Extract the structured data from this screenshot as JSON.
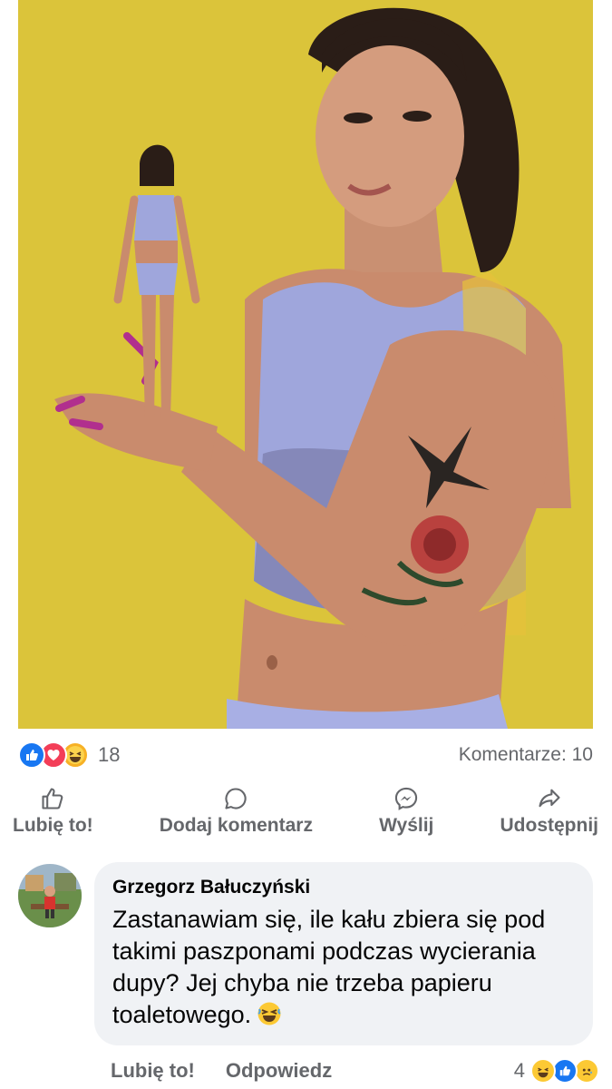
{
  "post": {
    "image_icon": "photo-woman-holding-doll"
  },
  "reactions": {
    "icons": [
      "like-icon",
      "love-icon",
      "haha-icon"
    ],
    "count": "18",
    "comments_label": "Komentarze: 10"
  },
  "actions": {
    "like": "Lubię to!",
    "comment": "Dodaj komentarz",
    "send": "Wyślij",
    "share": "Udostępnij"
  },
  "comment": {
    "author": "Grzegorz Bałuczyński",
    "text": "Zastanawiam się, ile kału zbiera się pod takimi paszponami podczas wycierania dupy? Jej chyba nie trzeba papieru toaletowego.",
    "like_label": "Lubię to!",
    "reply_label": "Odpowiedz",
    "reaction_count": "4",
    "reaction_icons": [
      "haha-icon",
      "like-icon",
      "sad-icon"
    ]
  },
  "colors": {
    "accent": "#1877f2",
    "love": "#f33e58",
    "haha": "#f7b125",
    "muted_text": "#65676b",
    "bubble": "#f0f2f5",
    "photo_background": "#d9c23a"
  }
}
